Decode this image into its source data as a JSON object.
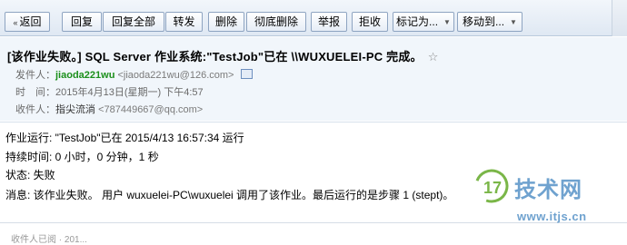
{
  "toolbar": {
    "back_label": "返回",
    "reply_label": "回复",
    "reply_all_label": "回复全部",
    "forward_label": "转发",
    "delete_label": "删除",
    "perm_delete_label": "彻底删除",
    "report_label": "举报",
    "reject_label": "拒收",
    "mark_as_label": "标记为...",
    "move_to_label": "移动到..."
  },
  "email": {
    "subject": "[该作业失败。] SQL Server 作业系统:\"TestJob\"已在 \\\\WUXUELEI-PC 完成。",
    "star_icon": "☆",
    "sender_label": "发件人：",
    "sender_name": "jiaoda221wu",
    "sender_address": "<jiaoda221wu@126.com>",
    "time_label": "时　间：",
    "time_value": "2015年4月13日(星期一) 下午4:57",
    "recipient_label": "收件人：",
    "recipient_name": "指尖流淌",
    "recipient_address": "<787449667@qq.com>"
  },
  "body": {
    "line1": "作业运行: \"TestJob\"已在 2015/4/13 16:57:34 运行",
    "line2": "持续时间: 0 小时，0 分钟，1 秒",
    "line3": "状态: 失败",
    "line4": "消息: 该作业失败。  用户 wuxuelei-PC\\wuxuelei 调用了该作业。最后运行的是步骤 1 (stept)。",
    "footer": "收件人已阅 · 201..."
  },
  "watermark": {
    "brand": "技术网",
    "url": "www.itjs.cn",
    "logo_color": "#7ab648",
    "text_color": "#6fa2cf"
  },
  "colors": {
    "toolbar_bg": "#e6edf6",
    "header_bg": "#f1f6fb",
    "sender_green": "#1b8f1b"
  }
}
